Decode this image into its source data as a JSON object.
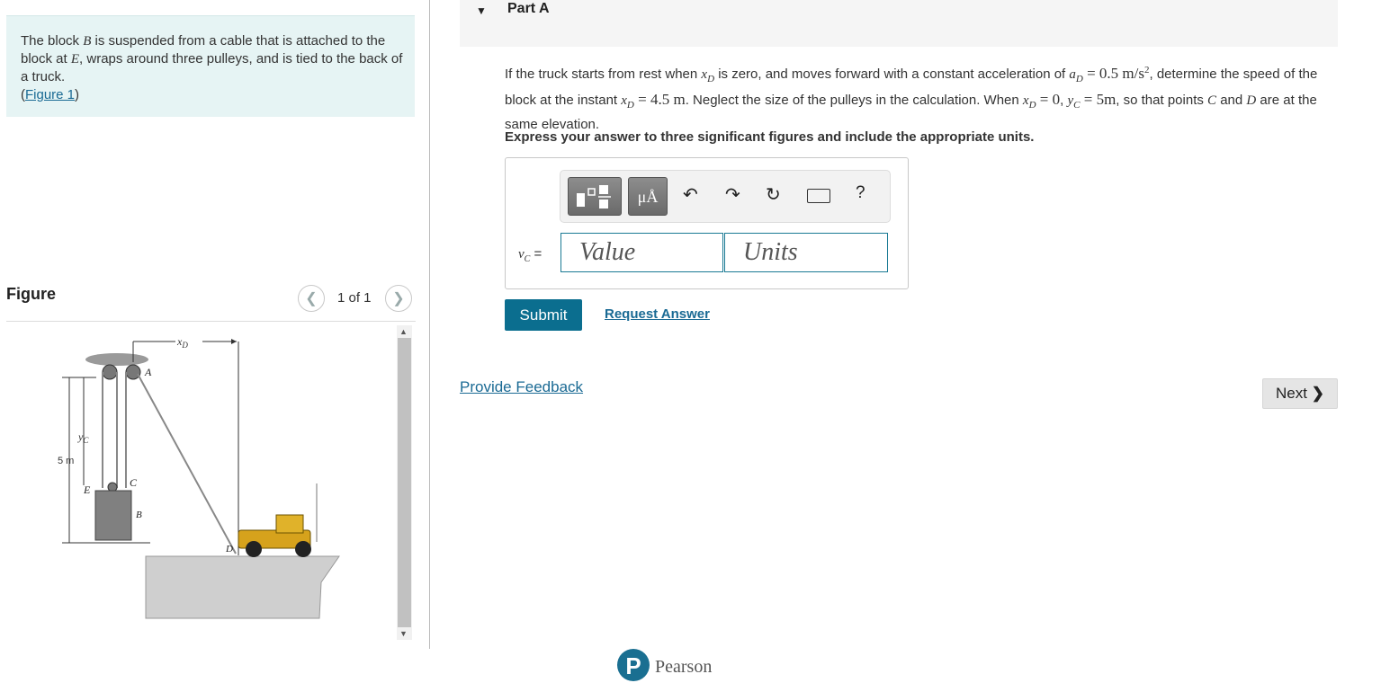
{
  "problem": {
    "text_1": "The block ",
    "var_B": "B",
    "text_2": " is suspended from a cable that is attached to the block at ",
    "var_E": "E",
    "text_3": ", wraps around three pulleys, and is tied to the back of a truck.",
    "figure_link_open": "(",
    "figure_link": "Figure 1",
    "figure_link_close": ")"
  },
  "figure_panel": {
    "title": "Figure",
    "counter": "1 of 1",
    "prev_icon": "chevron-left-icon",
    "next_icon": "chevron-right-icon",
    "labels": {
      "xD": "x",
      "xD_sub": "D",
      "A": "A",
      "yC": "y",
      "yC_sub": "C",
      "five_m": "5 m",
      "E": "E",
      "C": "C",
      "B": "B",
      "D": "D"
    }
  },
  "part": {
    "title": "Part A",
    "caret_icon": "triangle-down-icon",
    "question": {
      "t1": "If the truck starts from rest when ",
      "xD": "x",
      "xD_sub": "D",
      "t2": " is zero, and moves forward with a constant acceleration of ",
      "aD": "a",
      "aD_sub": "D",
      "aD_val": " = 0.5 m/s",
      "aD_exp": "2",
      "t3": ", determine the speed of the block at the instant ",
      "xD2": "x",
      "xD2_sub": "D",
      "xD2_val": " = 4.5 m",
      "t4": ". Neglect the size of the pulleys in the calculation. When ",
      "xD3": "x",
      "xD3_sub": "D",
      "xD3_val": " = 0",
      "t5": ", ",
      "yC": "y",
      "yC_sub": "C",
      "yC_val": " = 5m",
      "t6": ", so that points ",
      "C": "C",
      "t7": " and ",
      "D": "D",
      "t8": " are at the same elevation."
    },
    "instruction": "Express your answer to three significant figures and include the appropriate units."
  },
  "answer": {
    "toolbar": {
      "units_label": "μÅ",
      "undo_icon": "undo-icon",
      "redo_icon": "redo-icon",
      "reset_icon": "reset-icon",
      "keyboard_icon": "keyboard-icon",
      "help_label": "?"
    },
    "var_name": "v",
    "var_sub": "C",
    "equals": " =",
    "value_placeholder": "Value",
    "units_placeholder": "Units"
  },
  "actions": {
    "submit": "Submit",
    "request_answer": "Request Answer",
    "provide_feedback": "Provide Feedback",
    "next": "Next",
    "next_icon": "chevron-right-icon"
  },
  "footer": {
    "logo_letter": "P",
    "brand": "Pearson"
  },
  "colors": {
    "problem_bg": "#e6f4f4",
    "accent": "#0b6e8f",
    "link": "#1a6a94"
  }
}
